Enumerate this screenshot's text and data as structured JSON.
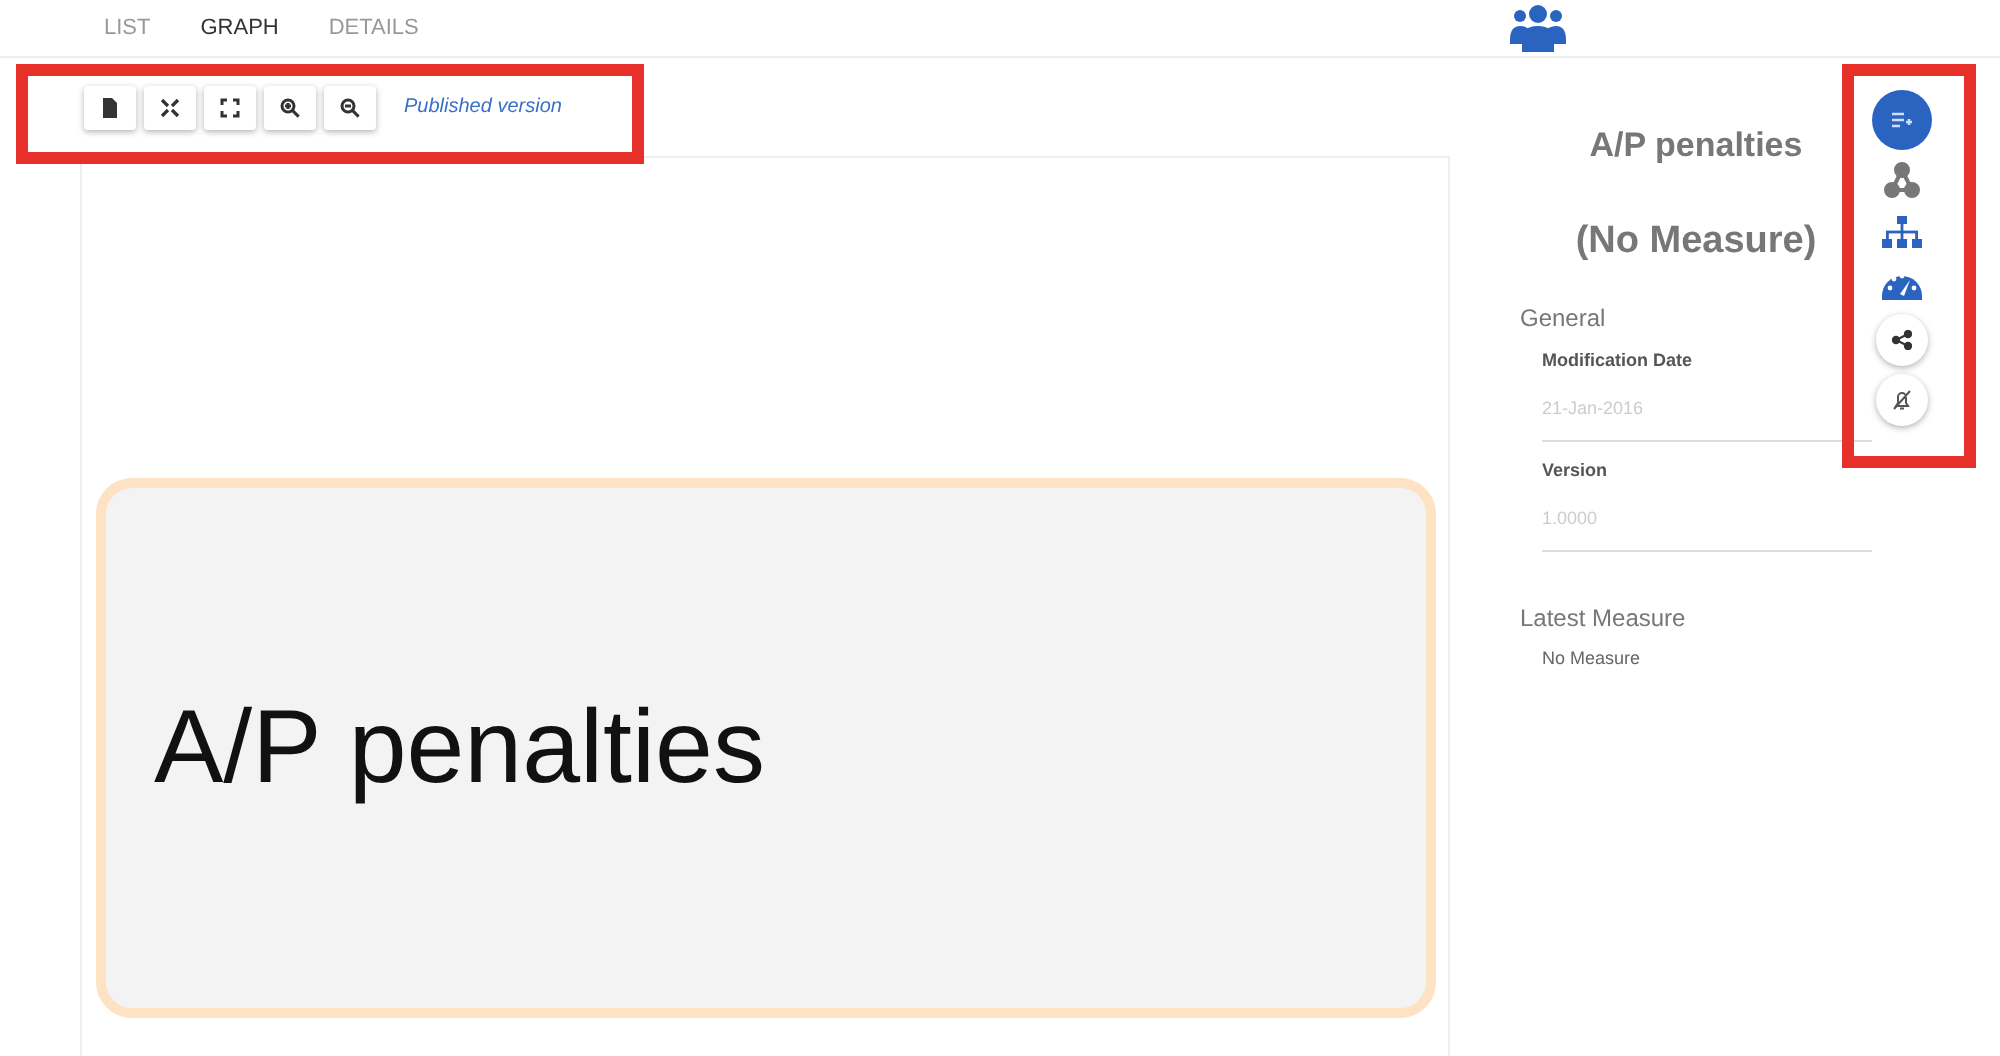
{
  "tabs": [
    {
      "label": "LIST",
      "selected": false
    },
    {
      "label": "GRAPH",
      "selected": true
    },
    {
      "label": "DETAILS",
      "selected": false
    }
  ],
  "toolbar": {
    "buttons": [
      {
        "kind": "document"
      },
      {
        "kind": "fit"
      },
      {
        "kind": "fullscreen"
      },
      {
        "kind": "zoom-in"
      },
      {
        "kind": "zoom-out"
      }
    ],
    "version_link": "Published version"
  },
  "graph": {
    "node": {
      "label": "A/P penalties"
    }
  },
  "details": {
    "title": "A/P penalties",
    "subtitle": "(No Measure)",
    "sections": [
      {
        "heading": "General",
        "fields": [
          {
            "label": "Modification Date",
            "value": "21-Jan-2016"
          },
          {
            "label": "Version",
            "value": "1.0000"
          }
        ]
      },
      {
        "heading": "Latest Measure",
        "text": "No Measure"
      }
    ]
  },
  "side_actions": [
    {
      "kind": "add"
    },
    {
      "kind": "nodes"
    },
    {
      "kind": "hierarchy"
    },
    {
      "kind": "gauge"
    },
    {
      "kind": "share"
    },
    {
      "kind": "mute"
    }
  ]
}
